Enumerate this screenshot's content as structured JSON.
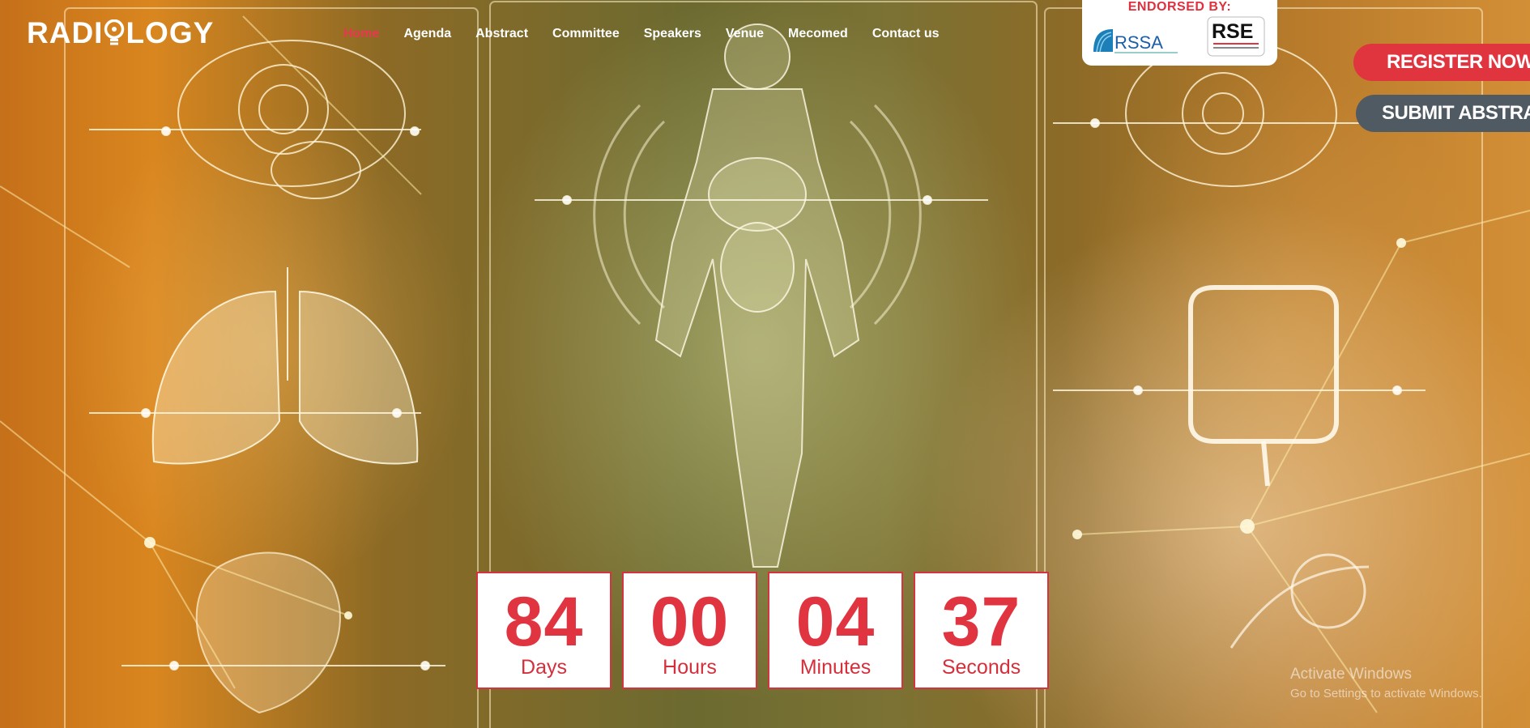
{
  "brand": {
    "logo_text_left": "RADI",
    "logo_text_right": "LOGY"
  },
  "nav": {
    "items": [
      {
        "label": "Home",
        "active": true
      },
      {
        "label": "Agenda"
      },
      {
        "label": "Abstract"
      },
      {
        "label": "Committee"
      },
      {
        "label": "Speakers"
      },
      {
        "label": "Venue"
      },
      {
        "label": "Mecomed"
      },
      {
        "label": "Contact us"
      }
    ]
  },
  "endorsed": {
    "title": "ENDORSED BY:",
    "logos": [
      {
        "name": "RSSA",
        "text": "RSSA"
      },
      {
        "name": "RSE",
        "text": "RSE"
      }
    ]
  },
  "cta": {
    "register": "REGISTER NOW",
    "submit": "SUBMIT ABSTRACT"
  },
  "countdown": [
    {
      "value": "84",
      "label": "Days"
    },
    {
      "value": "00",
      "label": "Hours"
    },
    {
      "value": "04",
      "label": "Minutes"
    },
    {
      "value": "37",
      "label": "Seconds"
    }
  ],
  "watermark": {
    "line1": "Activate Windows",
    "line2": "Go to Settings to activate Windows."
  },
  "colors": {
    "accent": "#e0343f",
    "nav_active": "#e8384f",
    "submit_bg": "#505a63",
    "background_warm": "#d9861f"
  }
}
